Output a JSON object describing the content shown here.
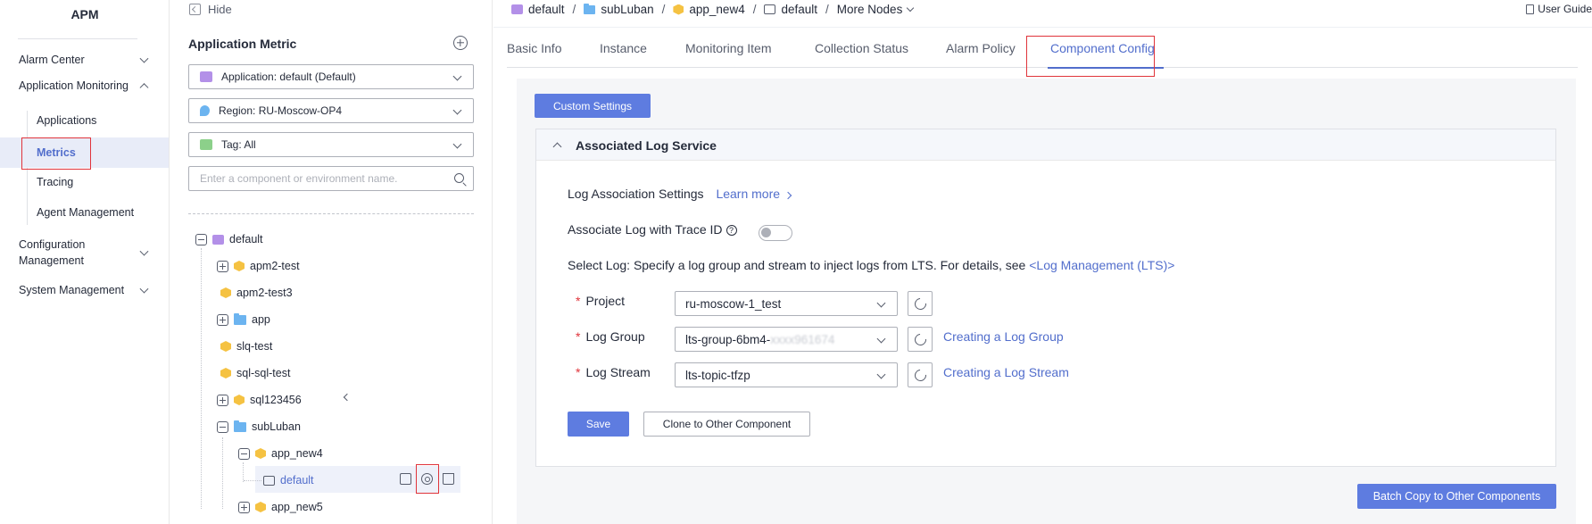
{
  "nav": {
    "brand": "APM",
    "items": [
      {
        "label": "Alarm Center"
      },
      {
        "label": "Application Monitoring"
      },
      {
        "label": "Configuration Management"
      },
      {
        "label": "System Management"
      }
    ],
    "sub": [
      "Applications",
      "Metrics",
      "Tracing",
      "Agent Management"
    ],
    "config_line1": "Configuration",
    "config_line2": "Management"
  },
  "tree_panel": {
    "hide_label": "Hide",
    "title": "Application Metric",
    "application_select": "Application:   default (Default)",
    "region_select": "Region:   RU-Moscow-OP4",
    "tag_select": "Tag:   All",
    "search_placeholder": "Enter a component or environment name.",
    "nodes": {
      "root": "default",
      "n1": "apm2-test",
      "n2": "apm2-test3",
      "n3": "app",
      "n4": "slq-test",
      "n5": "sql-sql-test",
      "n6": "sql123456",
      "n7": "subLuban",
      "n8": "app_new4",
      "n9": "default",
      "n10": "app_new5"
    }
  },
  "breadcrumb": {
    "b1": "default",
    "b2": "subLuban",
    "b3": "app_new4",
    "b4": "default",
    "more": "More Nodes",
    "sep": "/"
  },
  "user_guide": "User Guide",
  "tabs": [
    "Basic Info",
    "Instance",
    "Monitoring Item",
    "Collection Status",
    "Alarm Policy",
    "Component Config"
  ],
  "custom_settings_btn": "Custom Settings",
  "log_card": {
    "title": "Associated Log Service",
    "settings_label": "Log Association Settings",
    "learn_more": "Learn more",
    "trace_label": "Associate Log with Trace ID",
    "help_glyph": "?",
    "select_log_text": "Select Log: Specify a log group and stream to inject logs from LTS. For details, see",
    "lts_link": "<Log Management (LTS)>",
    "project_label": "Project",
    "project_value": "ru-moscow-1_test",
    "group_label": "Log Group",
    "group_value_prefix": "lts-group-6bm4-",
    "group_value_blur": "xxxx961674",
    "group_link": "Creating a Log Group",
    "stream_label": "Log Stream",
    "stream_value": "lts-topic-tfzp",
    "stream_link": "Creating a Log Stream",
    "save_btn": "Save",
    "clone_btn": "Clone to Other Component"
  },
  "batch_copy_btn": "Batch Copy to Other Components",
  "colors": {
    "accent": "#526ecc",
    "primary_btn": "#5e7ce0",
    "highlight_box": "#e0343b"
  }
}
